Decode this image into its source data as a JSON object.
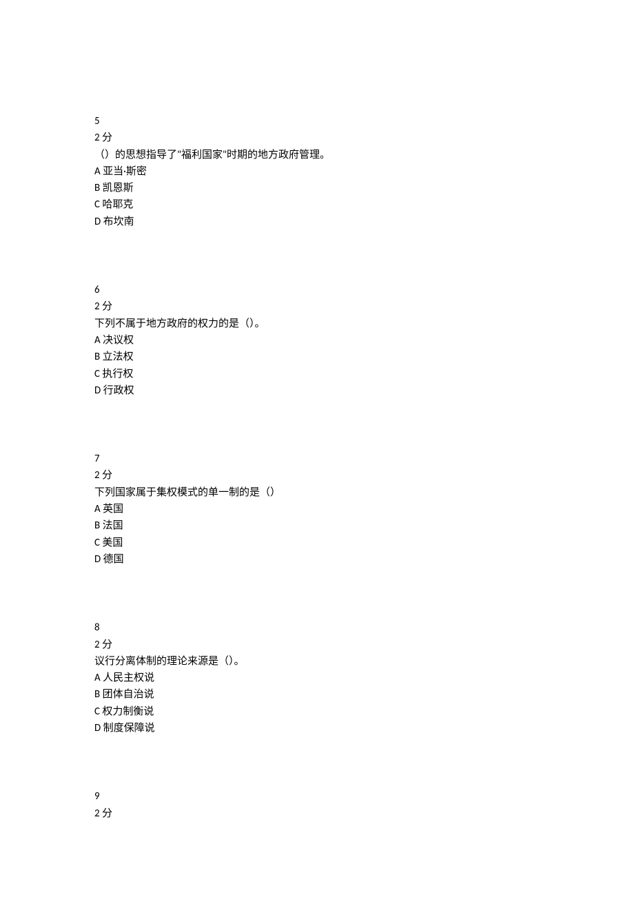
{
  "questions": [
    {
      "number": "5",
      "points": "2 分",
      "text": "（）的思想指导了\"福利国家\"时期的地方政府管理。",
      "options": [
        {
          "letter": "A",
          "text": " 亚当·斯密"
        },
        {
          "letter": "B",
          "text": " 凯恩斯"
        },
        {
          "letter": "C",
          "text": " 哈耶克"
        },
        {
          "letter": "D",
          "text": " 布坎南"
        }
      ]
    },
    {
      "number": "6",
      "points": "2 分",
      "text": "下列不属于地方政府的权力的是（）。",
      "options": [
        {
          "letter": "A",
          "text": " 决议权"
        },
        {
          "letter": "B",
          "text": " 立法权"
        },
        {
          "letter": "C",
          "text": " 执行权"
        },
        {
          "letter": "D",
          "text": " 行政权"
        }
      ]
    },
    {
      "number": "7",
      "points": "2 分",
      "text": "下列国家属于集权模式的单一制的是（）",
      "options": [
        {
          "letter": "A",
          "text": " 英国"
        },
        {
          "letter": "B",
          "text": " 法国"
        },
        {
          "letter": "C",
          "text": " 美国"
        },
        {
          "letter": "D",
          "text": " 德国"
        }
      ]
    },
    {
      "number": "8",
      "points": "2 分",
      "text": "议行分离体制的理论来源是（）。",
      "options": [
        {
          "letter": "A",
          "text": " 人民主权说"
        },
        {
          "letter": "B",
          "text": " 团体自治说"
        },
        {
          "letter": "C",
          "text": " 权力制衡说"
        },
        {
          "letter": "D",
          "text": " 制度保障说"
        }
      ]
    },
    {
      "number": "9",
      "points": "2 分",
      "text": "",
      "options": []
    }
  ]
}
